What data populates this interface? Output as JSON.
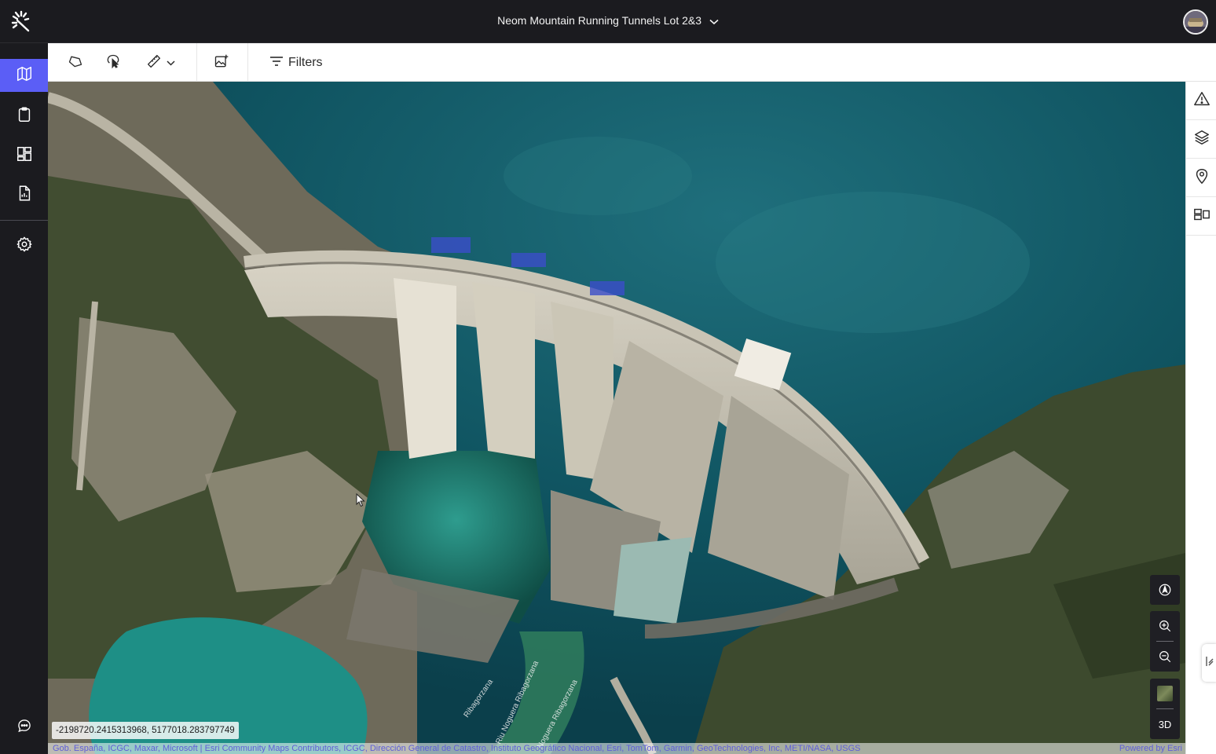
{
  "header": {
    "project_title": "Neom Mountain Running Tunnels Lot 2&3",
    "logo_icon": "sparkle-logo-icon",
    "avatar_icon": "user-avatar"
  },
  "left_nav": {
    "items": [
      {
        "icon": "map-icon",
        "active": true
      },
      {
        "icon": "clipboard-icon",
        "active": false
      },
      {
        "icon": "dashboard-icon",
        "active": false
      },
      {
        "icon": "report-icon",
        "active": false
      },
      {
        "icon": "settings-icon",
        "active": false
      }
    ],
    "bottom_icon": "chat-icon",
    "accent_color": "#5b5ef6"
  },
  "toolbar": {
    "tools": [
      "polygon-icon",
      "lasso-select-icon",
      "measure-ruler-icon",
      "add-image-icon"
    ],
    "filters_label": "Filters"
  },
  "right_rail": {
    "items": [
      "warning-icon",
      "layers-icon",
      "location-pin-icon",
      "layout-icon"
    ]
  },
  "map": {
    "coordinates": "-2198720.2415313968, 5177018.283797749",
    "attribution": "Gob. España, ICGC, Maxar, Microsoft | Esri Community Maps Contributors, ICGC, Dirección General de Catastro, Instituto Geográfico Nacional, Esri, TomTom, Garmin, GeoTechnologies, Inc, METI/NASA, USGS",
    "powered_by": "Powered by Esri",
    "controls": {
      "compass_icon": "compass-icon",
      "zoom_in_icon": "zoom-in-icon",
      "zoom_out_icon": "zoom-out-icon",
      "basemap_icon": "basemap-thumbnail",
      "view_3d_label": "3D"
    },
    "road_labels": [
      "Riu Noguera Ribagorzana",
      "Noguera Ribagorzana",
      "Ribagorzana"
    ]
  }
}
